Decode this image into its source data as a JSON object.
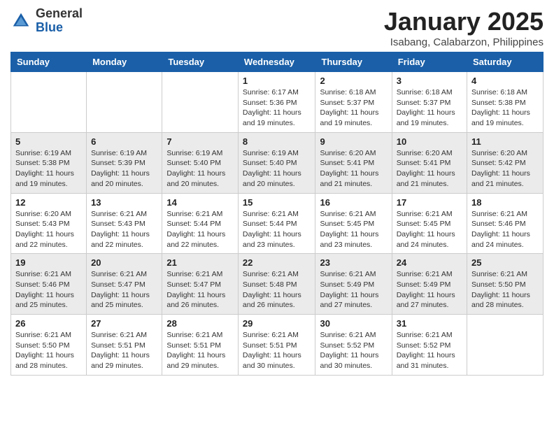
{
  "header": {
    "logo_general": "General",
    "logo_blue": "Blue",
    "month_title": "January 2025",
    "location": "Isabang, Calabarzon, Philippines"
  },
  "weekdays": [
    "Sunday",
    "Monday",
    "Tuesday",
    "Wednesday",
    "Thursday",
    "Friday",
    "Saturday"
  ],
  "weeks": [
    [
      {
        "day": "",
        "sunrise": "",
        "sunset": "",
        "daylight": ""
      },
      {
        "day": "",
        "sunrise": "",
        "sunset": "",
        "daylight": ""
      },
      {
        "day": "",
        "sunrise": "",
        "sunset": "",
        "daylight": ""
      },
      {
        "day": "1",
        "sunrise": "Sunrise: 6:17 AM",
        "sunset": "Sunset: 5:36 PM",
        "daylight": "Daylight: 11 hours and 19 minutes."
      },
      {
        "day": "2",
        "sunrise": "Sunrise: 6:18 AM",
        "sunset": "Sunset: 5:37 PM",
        "daylight": "Daylight: 11 hours and 19 minutes."
      },
      {
        "day": "3",
        "sunrise": "Sunrise: 6:18 AM",
        "sunset": "Sunset: 5:37 PM",
        "daylight": "Daylight: 11 hours and 19 minutes."
      },
      {
        "day": "4",
        "sunrise": "Sunrise: 6:18 AM",
        "sunset": "Sunset: 5:38 PM",
        "daylight": "Daylight: 11 hours and 19 minutes."
      }
    ],
    [
      {
        "day": "5",
        "sunrise": "Sunrise: 6:19 AM",
        "sunset": "Sunset: 5:38 PM",
        "daylight": "Daylight: 11 hours and 19 minutes."
      },
      {
        "day": "6",
        "sunrise": "Sunrise: 6:19 AM",
        "sunset": "Sunset: 5:39 PM",
        "daylight": "Daylight: 11 hours and 20 minutes."
      },
      {
        "day": "7",
        "sunrise": "Sunrise: 6:19 AM",
        "sunset": "Sunset: 5:40 PM",
        "daylight": "Daylight: 11 hours and 20 minutes."
      },
      {
        "day": "8",
        "sunrise": "Sunrise: 6:19 AM",
        "sunset": "Sunset: 5:40 PM",
        "daylight": "Daylight: 11 hours and 20 minutes."
      },
      {
        "day": "9",
        "sunrise": "Sunrise: 6:20 AM",
        "sunset": "Sunset: 5:41 PM",
        "daylight": "Daylight: 11 hours and 21 minutes."
      },
      {
        "day": "10",
        "sunrise": "Sunrise: 6:20 AM",
        "sunset": "Sunset: 5:41 PM",
        "daylight": "Daylight: 11 hours and 21 minutes."
      },
      {
        "day": "11",
        "sunrise": "Sunrise: 6:20 AM",
        "sunset": "Sunset: 5:42 PM",
        "daylight": "Daylight: 11 hours and 21 minutes."
      }
    ],
    [
      {
        "day": "12",
        "sunrise": "Sunrise: 6:20 AM",
        "sunset": "Sunset: 5:43 PM",
        "daylight": "Daylight: 11 hours and 22 minutes."
      },
      {
        "day": "13",
        "sunrise": "Sunrise: 6:21 AM",
        "sunset": "Sunset: 5:43 PM",
        "daylight": "Daylight: 11 hours and 22 minutes."
      },
      {
        "day": "14",
        "sunrise": "Sunrise: 6:21 AM",
        "sunset": "Sunset: 5:44 PM",
        "daylight": "Daylight: 11 hours and 22 minutes."
      },
      {
        "day": "15",
        "sunrise": "Sunrise: 6:21 AM",
        "sunset": "Sunset: 5:44 PM",
        "daylight": "Daylight: 11 hours and 23 minutes."
      },
      {
        "day": "16",
        "sunrise": "Sunrise: 6:21 AM",
        "sunset": "Sunset: 5:45 PM",
        "daylight": "Daylight: 11 hours and 23 minutes."
      },
      {
        "day": "17",
        "sunrise": "Sunrise: 6:21 AM",
        "sunset": "Sunset: 5:45 PM",
        "daylight": "Daylight: 11 hours and 24 minutes."
      },
      {
        "day": "18",
        "sunrise": "Sunrise: 6:21 AM",
        "sunset": "Sunset: 5:46 PM",
        "daylight": "Daylight: 11 hours and 24 minutes."
      }
    ],
    [
      {
        "day": "19",
        "sunrise": "Sunrise: 6:21 AM",
        "sunset": "Sunset: 5:46 PM",
        "daylight": "Daylight: 11 hours and 25 minutes."
      },
      {
        "day": "20",
        "sunrise": "Sunrise: 6:21 AM",
        "sunset": "Sunset: 5:47 PM",
        "daylight": "Daylight: 11 hours and 25 minutes."
      },
      {
        "day": "21",
        "sunrise": "Sunrise: 6:21 AM",
        "sunset": "Sunset: 5:47 PM",
        "daylight": "Daylight: 11 hours and 26 minutes."
      },
      {
        "day": "22",
        "sunrise": "Sunrise: 6:21 AM",
        "sunset": "Sunset: 5:48 PM",
        "daylight": "Daylight: 11 hours and 26 minutes."
      },
      {
        "day": "23",
        "sunrise": "Sunrise: 6:21 AM",
        "sunset": "Sunset: 5:49 PM",
        "daylight": "Daylight: 11 hours and 27 minutes."
      },
      {
        "day": "24",
        "sunrise": "Sunrise: 6:21 AM",
        "sunset": "Sunset: 5:49 PM",
        "daylight": "Daylight: 11 hours and 27 minutes."
      },
      {
        "day": "25",
        "sunrise": "Sunrise: 6:21 AM",
        "sunset": "Sunset: 5:50 PM",
        "daylight": "Daylight: 11 hours and 28 minutes."
      }
    ],
    [
      {
        "day": "26",
        "sunrise": "Sunrise: 6:21 AM",
        "sunset": "Sunset: 5:50 PM",
        "daylight": "Daylight: 11 hours and 28 minutes."
      },
      {
        "day": "27",
        "sunrise": "Sunrise: 6:21 AM",
        "sunset": "Sunset: 5:51 PM",
        "daylight": "Daylight: 11 hours and 29 minutes."
      },
      {
        "day": "28",
        "sunrise": "Sunrise: 6:21 AM",
        "sunset": "Sunset: 5:51 PM",
        "daylight": "Daylight: 11 hours and 29 minutes."
      },
      {
        "day": "29",
        "sunrise": "Sunrise: 6:21 AM",
        "sunset": "Sunset: 5:51 PM",
        "daylight": "Daylight: 11 hours and 30 minutes."
      },
      {
        "day": "30",
        "sunrise": "Sunrise: 6:21 AM",
        "sunset": "Sunset: 5:52 PM",
        "daylight": "Daylight: 11 hours and 30 minutes."
      },
      {
        "day": "31",
        "sunrise": "Sunrise: 6:21 AM",
        "sunset": "Sunset: 5:52 PM",
        "daylight": "Daylight: 11 hours and 31 minutes."
      },
      {
        "day": "",
        "sunrise": "",
        "sunset": "",
        "daylight": ""
      }
    ]
  ]
}
